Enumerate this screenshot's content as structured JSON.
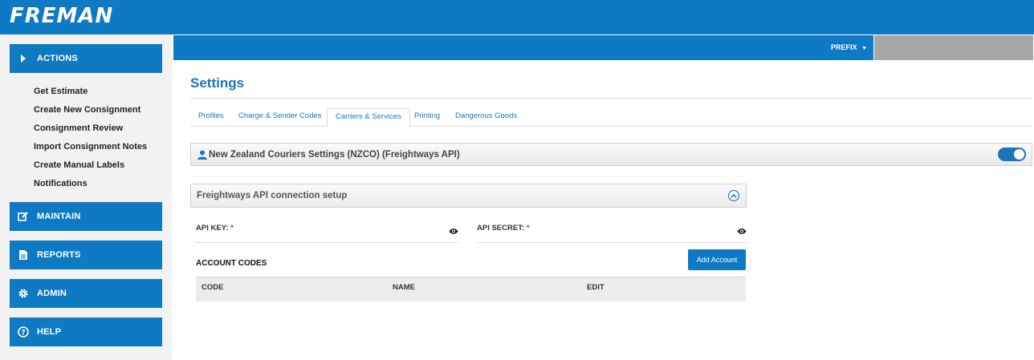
{
  "app": {
    "logo": "FREMAN"
  },
  "sidebar": {
    "actions_label": "ACTIONS",
    "sub_items": [
      "Get Estimate",
      "Create New Consignment",
      "Consignment Review",
      "Import Consignment Notes",
      "Create Manual Labels",
      "Notifications"
    ],
    "maintain_label": "MAINTAIN",
    "reports_label": "REPORTS",
    "admin_label": "ADMIN",
    "help_label": "HELP"
  },
  "header": {
    "prefix_label": "PREFIX"
  },
  "page": {
    "title": "Settings"
  },
  "tabs": [
    {
      "label": "Profiles",
      "active": false
    },
    {
      "label": "Charge & Sender Codes",
      "active": false
    },
    {
      "label": "Carriers & Services",
      "active": true
    },
    {
      "label": "Printing",
      "active": false
    },
    {
      "label": "Dangerous Goods",
      "active": false
    }
  ],
  "carrier": {
    "title": "New Zealand Couriers Settings (NZCO) (Freightways API)",
    "enabled": true
  },
  "api_panel": {
    "title": "Freightways API connection setup"
  },
  "fields": {
    "api_key_label": "API KEY:",
    "api_secret_label": "API SECRET:",
    "required_mark": "*"
  },
  "accounts": {
    "title": "ACCOUNT CODES",
    "add_button": "Add Account",
    "columns": [
      "CODE",
      "NAME",
      "EDIT"
    ]
  },
  "colors": {
    "brand": "#0e7ac4",
    "link": "#1a75bb",
    "required": "#d9241c"
  }
}
